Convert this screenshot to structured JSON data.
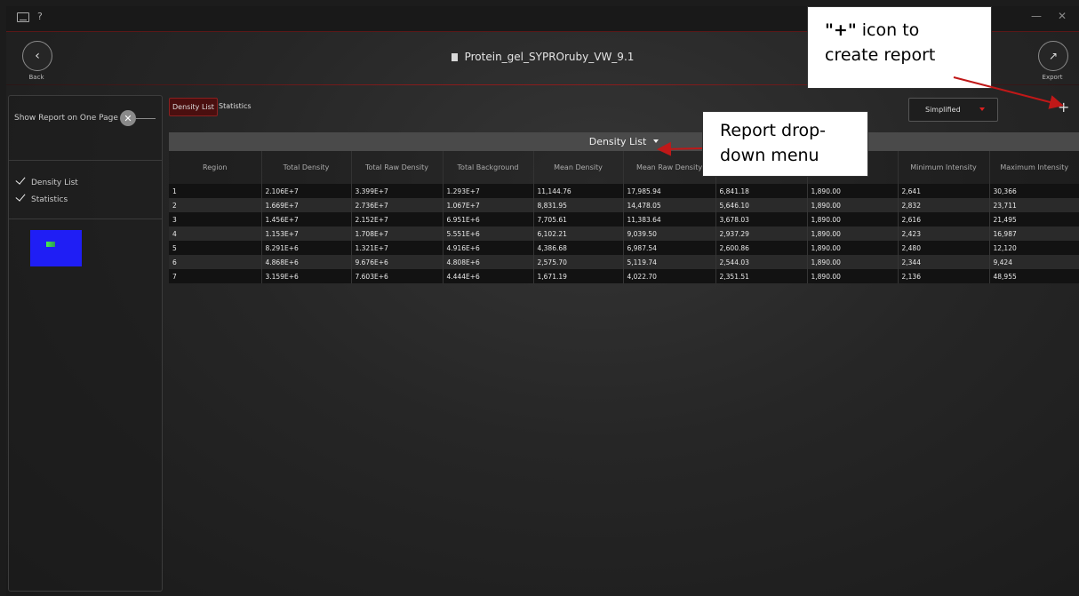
{
  "titlebar": {
    "help": "?",
    "minimize": "—",
    "close": "✕"
  },
  "header": {
    "back_label": "Back",
    "file_title": "Protein_gel_SYPROruby_VW_9.1",
    "export_label": "Export"
  },
  "sidebar": {
    "show_report_label": "Show Report on One Page",
    "items": [
      {
        "label": "Density List"
      },
      {
        "label": "Statistics"
      }
    ]
  },
  "tabs": [
    {
      "label": "Density List",
      "active": true
    },
    {
      "label": "Statistics",
      "active": false
    }
  ],
  "view_dropdown": {
    "selected": "Simplified"
  },
  "report": {
    "title": "Density List",
    "columns": [
      "Region",
      "Total Density",
      "Total Raw Density",
      "Total Background",
      "Mean Density",
      "Mean Raw Density",
      "",
      "",
      "Minimum Intensity",
      "Maximum Intensity"
    ],
    "rows": [
      [
        "1",
        "2.106E+7",
        "3.399E+7",
        "1.293E+7",
        "11,144.76",
        "17,985.94",
        "6,841.18",
        "1,890.00",
        "2,641",
        "30,366"
      ],
      [
        "2",
        "1.669E+7",
        "2.736E+7",
        "1.067E+7",
        "8,831.95",
        "14,478.05",
        "5,646.10",
        "1,890.00",
        "2,832",
        "23,711"
      ],
      [
        "3",
        "1.456E+7",
        "2.152E+7",
        "6.951E+6",
        "7,705.61",
        "11,383.64",
        "3,678.03",
        "1,890.00",
        "2,616",
        "21,495"
      ],
      [
        "4",
        "1.153E+7",
        "1.708E+7",
        "5.551E+6",
        "6,102.21",
        "9,039.50",
        "2,937.29",
        "1,890.00",
        "2,423",
        "16,987"
      ],
      [
        "5",
        "8.291E+6",
        "1.321E+7",
        "4.916E+6",
        "4,386.68",
        "6,987.54",
        "2,600.86",
        "1,890.00",
        "2,480",
        "12,120"
      ],
      [
        "6",
        "4.868E+6",
        "9.676E+6",
        "4.808E+6",
        "2,575.70",
        "5,119.74",
        "2,544.03",
        "1,890.00",
        "2,344",
        "9,424"
      ],
      [
        "7",
        "3.159E+6",
        "7.603E+6",
        "4.444E+6",
        "1,671.19",
        "4,022.70",
        "2,351.51",
        "1,890.00",
        "2,136",
        "48,955"
      ]
    ]
  },
  "annotations": {
    "plus_callout": {
      "bold": "\"+\"",
      "line1_rest": " icon to",
      "line2": "create report"
    },
    "dropdown_callout": {
      "line1": "Report drop-",
      "line2": "down menu"
    }
  },
  "colors": {
    "accent_red": "#c01818",
    "thumbnail_blue": "#1f1ef5"
  }
}
